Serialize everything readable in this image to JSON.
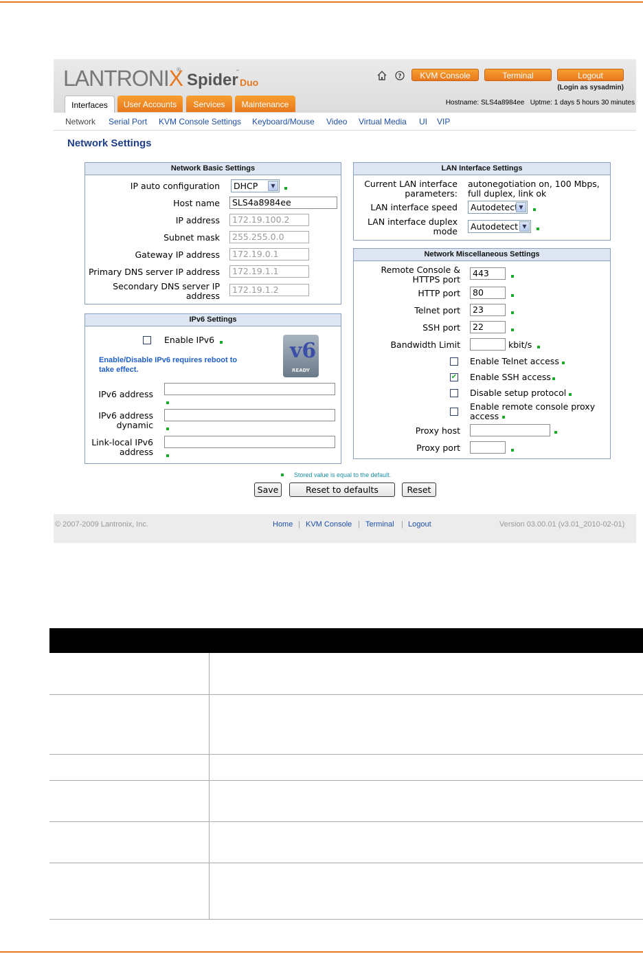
{
  "brand": {
    "logo_main": "LANTRONI",
    "logo_x": "X",
    "logo_reg": "®",
    "product": "Spider",
    "product_tm": "™",
    "product_suffix": "Duo"
  },
  "header": {
    "icons": [
      "home-icon",
      "help-icon"
    ],
    "buttons": {
      "kvm_console": "KVM Console",
      "terminal": "Terminal",
      "logout": "Logout"
    },
    "login_as": "(Login as sysadmin)",
    "hostname": "Hostname: SLS4a8984ee",
    "uptime": "Uptme: 1 days 5 hours 30 minutes"
  },
  "tabs": [
    "Interfaces",
    "User Accounts",
    "Services",
    "Maintenance"
  ],
  "active_tab": "Interfaces",
  "subnav": [
    "Network",
    "Serial Port",
    "KVM Console Settings",
    "Keyboard/Mouse",
    "Video",
    "Virtual Media",
    "UI",
    "VIP"
  ],
  "page_title": "Network Settings",
  "basic": {
    "title": "Network Basic Settings",
    "ip_auto_label": "IP auto configuration",
    "ip_auto_value": "DHCP",
    "host_label": "Host name",
    "host_value": "SLS4a8984ee",
    "ip_label": "IP address",
    "ip_value": "172.19.100.2",
    "mask_label": "Subnet mask",
    "mask_value": "255.255.0.0",
    "gw_label": "Gateway IP address",
    "gw_value": "172.19.0.1",
    "dns1_label": "Primary DNS server IP address",
    "dns1_value": "172.19.1.1",
    "dns2_label_1": "Secondary DNS server IP",
    "dns2_label_2": "address",
    "dns2_value": "172.19.1.2"
  },
  "ipv6": {
    "title": "IPv6 Settings",
    "enable_label": "Enable IPv6",
    "note_1": "Enable/Disable IPv6 requires reboot to",
    "note_2": "take effect.",
    "logo_big": "v6",
    "logo_ready": "READY",
    "addr_label": "IPv6 address",
    "dyn_label_1": "IPv6 address",
    "dyn_label_2": "dynamic",
    "link_label_1": "Link-local IPv6",
    "link_label_2": "address"
  },
  "lan": {
    "title": "LAN Interface Settings",
    "current_label_1": "Current LAN interface",
    "current_label_2": "parameters:",
    "current_value_1": "autonegotiation on, 100 Mbps,",
    "current_value_2": "full duplex, link ok",
    "speed_label": "LAN interface speed",
    "speed_value": "Autodetect",
    "duplex_label_1": "LAN interface duplex",
    "duplex_label_2": "mode",
    "duplex_value": "Autodetect"
  },
  "misc": {
    "title": "Network Miscellaneous Settings",
    "https_label_1": "Remote Console &",
    "https_label_2": "HTTPS port",
    "https_value": "443",
    "http_label": "HTTP port",
    "http_value": "80",
    "telnet_label": "Telnet port",
    "telnet_value": "23",
    "ssh_label": "SSH port",
    "ssh_value": "22",
    "bw_label": "Bandwidth Limit",
    "bw_value": "",
    "bw_unit": "kbit/s",
    "enable_telnet": "Enable Telnet access",
    "enable_telnet_checked": false,
    "enable_ssh": "Enable SSH access",
    "enable_ssh_checked": true,
    "disable_setup": "Disable setup protocol",
    "disable_setup_checked": false,
    "proxy_enable_1": "Enable remote console proxy",
    "proxy_enable_2": "access",
    "proxy_enable_checked": false,
    "proxy_host_label": "Proxy host",
    "proxy_host_value": "",
    "proxy_port_label": "Proxy port",
    "proxy_port_value": ""
  },
  "legend_note": "Stored value is equal to the default.",
  "actions": {
    "save": "Save",
    "reset_defaults": "Reset to defaults",
    "reset": "Reset"
  },
  "footer": {
    "copyright": "© 2007-2009 Lantronix, Inc.",
    "links": [
      "Home",
      "KVM Console",
      "Terminal",
      "Logout"
    ],
    "separator": "|",
    "version": "Version 03.00.01 (v3.01_2010-02-01)"
  },
  "colors": {
    "accent": "#e8781e",
    "link": "#1f4fa8",
    "default_marker": "#1aaa2a",
    "panel_header": "#dde6f2"
  }
}
